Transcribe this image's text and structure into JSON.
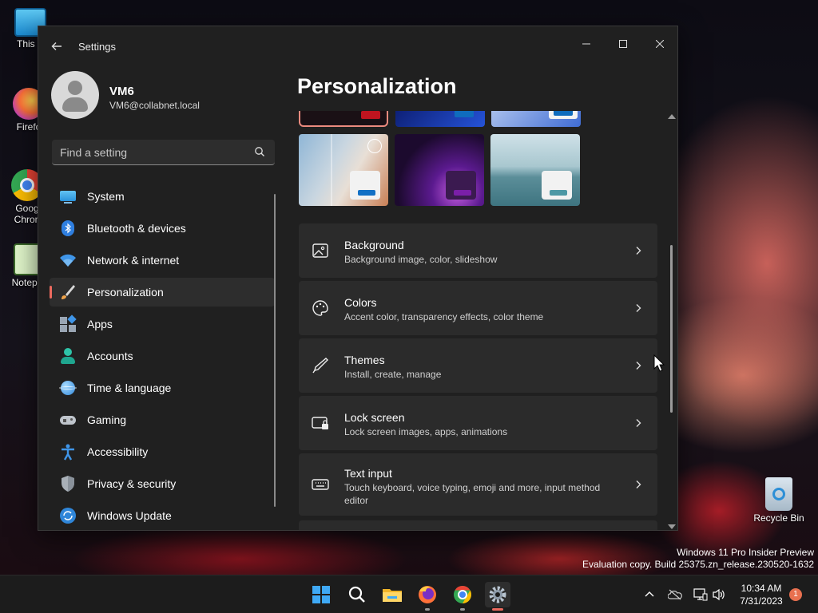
{
  "desktop": {
    "icons": [
      {
        "label": "This P",
        "icon": "monitor-icon"
      },
      {
        "label": "Firefo",
        "icon": "firefox-icon"
      },
      {
        "label": "Goog",
        "label2": "Chron",
        "icon": "chrome-icon"
      },
      {
        "label": "Notepa",
        "icon": "notepad-icon"
      }
    ],
    "recycle_bin": {
      "label": "Recycle Bin",
      "icon": "recycle-bin-icon"
    },
    "watermark": {
      "line1": "Windows 11 Pro Insider Preview",
      "line2": "Evaluation copy. Build 25375.zn_release.230520-1632"
    }
  },
  "window": {
    "title": "Settings",
    "controls": {
      "minimize": "minimize-icon",
      "maximize": "maximize-icon",
      "close": "close-icon"
    }
  },
  "user": {
    "name": "VM6",
    "email": "VM6@collabnet.local"
  },
  "search": {
    "placeholder": "Find a setting"
  },
  "nav": {
    "items": [
      {
        "label": "System",
        "icon": "system-icon"
      },
      {
        "label": "Bluetooth & devices",
        "icon": "bluetooth-icon"
      },
      {
        "label": "Network & internet",
        "icon": "wifi-icon"
      },
      {
        "label": "Personalization",
        "icon": "brush-icon",
        "active": true
      },
      {
        "label": "Apps",
        "icon": "apps-icon"
      },
      {
        "label": "Accounts",
        "icon": "account-icon"
      },
      {
        "label": "Time & language",
        "icon": "globe-icon"
      },
      {
        "label": "Gaming",
        "icon": "gamepad-icon"
      },
      {
        "label": "Accessibility",
        "icon": "accessibility-icon"
      },
      {
        "label": "Privacy & security",
        "icon": "shield-icon"
      },
      {
        "label": "Windows Update",
        "icon": "update-icon"
      }
    ]
  },
  "page": {
    "title": "Personalization",
    "cards": [
      {
        "title": "Background",
        "subtitle": "Background image, color, slideshow",
        "icon": "image-icon"
      },
      {
        "title": "Colors",
        "subtitle": "Accent color, transparency effects, color theme",
        "icon": "palette-icon"
      },
      {
        "title": "Themes",
        "subtitle": "Install, create, manage",
        "icon": "pen-icon"
      },
      {
        "title": "Lock screen",
        "subtitle": "Lock screen images, apps, animations",
        "icon": "lock-screen-icon"
      },
      {
        "title": "Text input",
        "subtitle": "Touch keyboard, voice typing, emoji and more, input method editor",
        "icon": "keyboard-icon"
      }
    ]
  },
  "colors": {
    "accent": "#ec6a5e",
    "window_bg": "#202020",
    "card_bg": "#2b2b2b"
  },
  "taskbar": {
    "apps": [
      "start-icon",
      "search-icon",
      "file-explorer-icon",
      "firefox-icon",
      "chrome-icon",
      "settings-icon"
    ],
    "clock": {
      "time": "10:34 AM",
      "date": "7/31/2023"
    },
    "notification_count": "1"
  }
}
